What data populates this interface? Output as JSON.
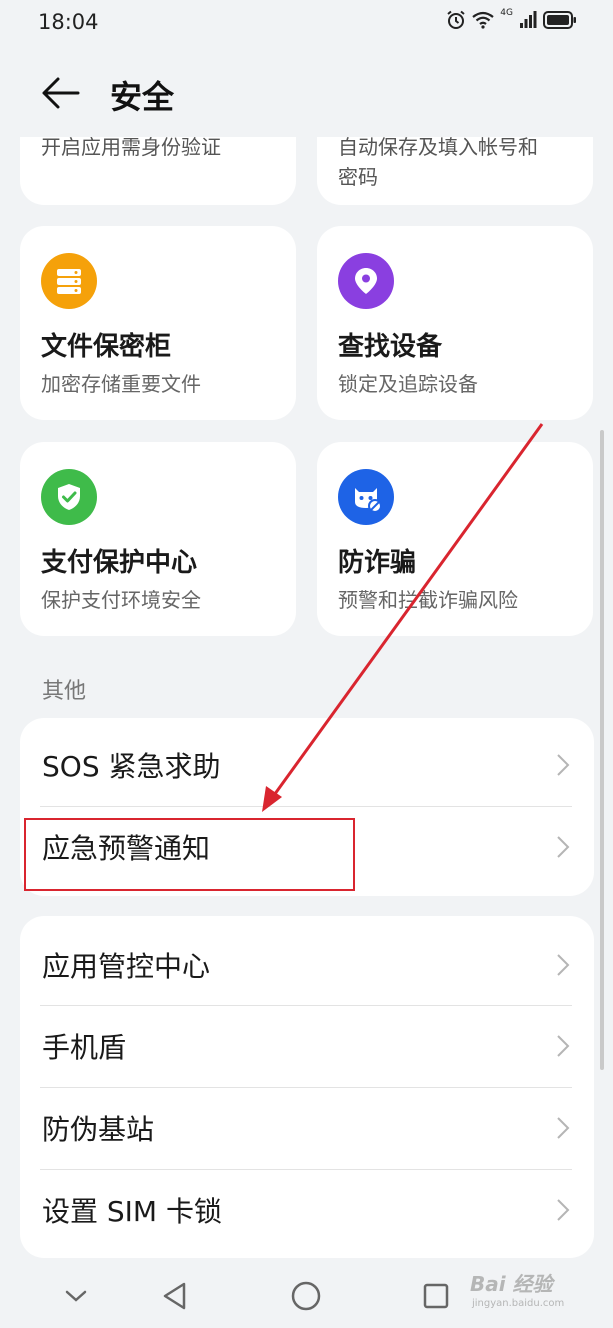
{
  "status_bar": {
    "time": "18:04",
    "network_label": "4G",
    "icons": [
      "alarm-icon",
      "wifi-icon",
      "signal-icon",
      "battery-icon"
    ]
  },
  "header": {
    "title": "安全",
    "back_icon": "arrow-left-icon"
  },
  "top_partial_cards": [
    {
      "text": "开启应用需身份验证"
    },
    {
      "text": "自动保存及填入帐号和",
      "text2": "密码"
    }
  ],
  "tiles": [
    {
      "title": "文件保密柜",
      "subtitle": "加密存储重要文件",
      "icon": "safe-box-icon",
      "color": "#f5a10a"
    },
    {
      "title": "查找设备",
      "subtitle": "锁定及追踪设备",
      "icon": "location-pin-icon",
      "color": "#8a3fe0"
    },
    {
      "title": "支付保护中心",
      "subtitle": "保护支付环境安全",
      "icon": "shield-check-icon",
      "color": "#3fbb4a"
    },
    {
      "title": "防诈骗",
      "subtitle": "预警和拦截诈骗风险",
      "icon": "anti-fraud-icon",
      "color": "#1e63e6"
    }
  ],
  "other_section": {
    "header": "其他",
    "group1": [
      "SOS 紧急求助",
      "应急预警通知"
    ],
    "group2": [
      "应用管控中心",
      "手机盾",
      "防伪基站",
      "设置 SIM 卡锁"
    ]
  },
  "annotation": {
    "color": "#d9252f"
  },
  "nav_bar": {
    "buttons": [
      "collapse-icon",
      "back-triangle-icon",
      "home-circle-icon",
      "recents-square-icon"
    ]
  },
  "watermark": {
    "brand": "Bai 经验",
    "url": "jingyan.baidu.com"
  }
}
